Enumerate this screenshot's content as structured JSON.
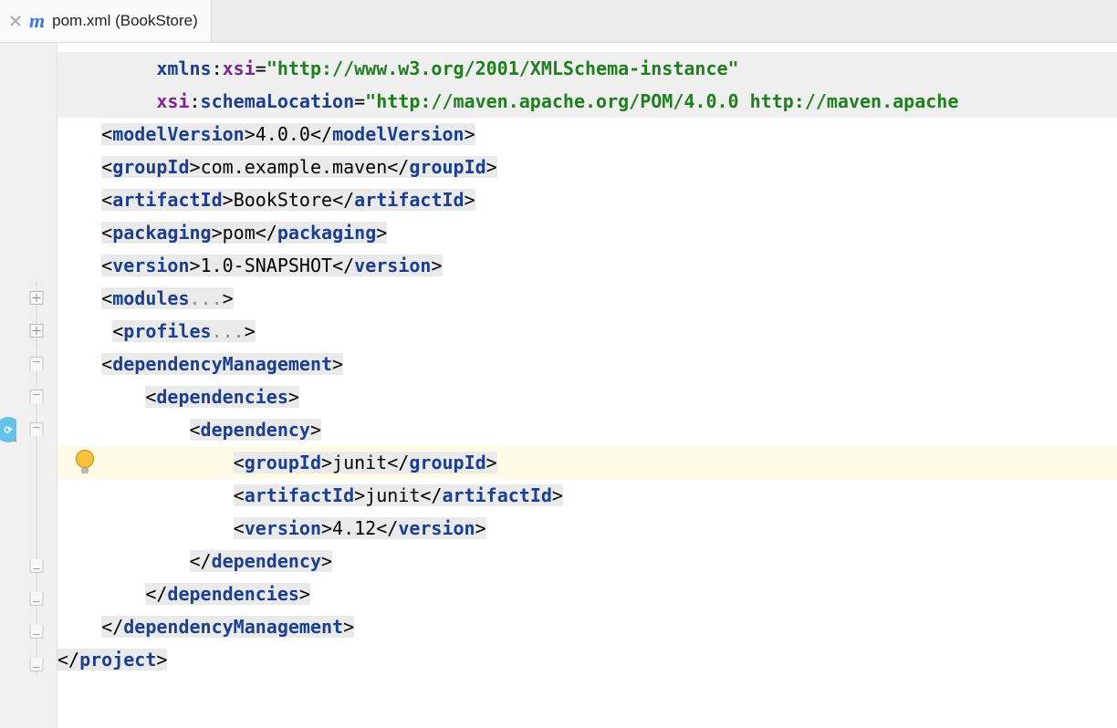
{
  "tab": {
    "title": "pom.xml (BookStore)"
  },
  "code": {
    "lines": [
      {
        "kind": "attrline",
        "indent": "         ",
        "attr": "xmlns",
        "ns": "xsi",
        "val": "\"http://www.w3.org/2001/XMLSchema-instance\"",
        "bg": "gray"
      },
      {
        "kind": "attrline2",
        "indent": "         ",
        "ns1": "xsi",
        "attr": "schemaLocation",
        "val": "\"http://maven.apache.org/POM/4.0.0 http://maven.apache",
        "bg": "gray"
      },
      {
        "kind": "tagtext",
        "indent": "    ",
        "tag": "modelVersion",
        "text": "4.0.0"
      },
      {
        "kind": "tagtext",
        "indent": "    ",
        "tag": "groupId",
        "text": "com.example.maven"
      },
      {
        "kind": "tagtext",
        "indent": "    ",
        "tag": "artifactId",
        "text": "BookStore"
      },
      {
        "kind": "tagtext",
        "indent": "    ",
        "tag": "packaging",
        "text": "pom"
      },
      {
        "kind": "tagtext",
        "indent": "    ",
        "tag": "version",
        "text": "1.0-SNAPSHOT"
      },
      {
        "kind": "folded",
        "indent": "    ",
        "tag": "modules"
      },
      {
        "kind": "folded",
        "indent": "     ",
        "tag": "profiles"
      },
      {
        "kind": "open",
        "indent": "    ",
        "tag": "dependencyManagement"
      },
      {
        "kind": "open",
        "indent": "        ",
        "tag": "dependencies"
      },
      {
        "kind": "open",
        "indent": "            ",
        "tag": "dependency"
      },
      {
        "kind": "tagtext",
        "indent": "                ",
        "tag": "groupId",
        "text": "junit",
        "hl": true
      },
      {
        "kind": "tagtext",
        "indent": "                ",
        "tag": "artifactId",
        "text": "junit"
      },
      {
        "kind": "tagtext",
        "indent": "                ",
        "tag": "version",
        "text": "4.12"
      },
      {
        "kind": "close",
        "indent": "            ",
        "tag": "dependency"
      },
      {
        "kind": "close",
        "indent": "        ",
        "tag": "dependencies"
      },
      {
        "kind": "close",
        "indent": "    ",
        "tag": "dependencyManagement"
      },
      {
        "kind": "close",
        "indent": "",
        "tag": "project"
      }
    ]
  },
  "gutter": {
    "icons": [
      {
        "line": 7,
        "type": "plus"
      },
      {
        "line": 8,
        "type": "plus"
      },
      {
        "line": 9,
        "type": "minus-top"
      },
      {
        "line": 10,
        "type": "minus-top"
      },
      {
        "line": 11,
        "type": "minus-top"
      },
      {
        "line": 15,
        "type": "minus-bot"
      },
      {
        "line": 16,
        "type": "minus-bot"
      },
      {
        "line": 17,
        "type": "minus-bot"
      },
      {
        "line": 18,
        "type": "minus-bot"
      }
    ],
    "bulb_line": 12,
    "refresh_badge_line": 11
  }
}
